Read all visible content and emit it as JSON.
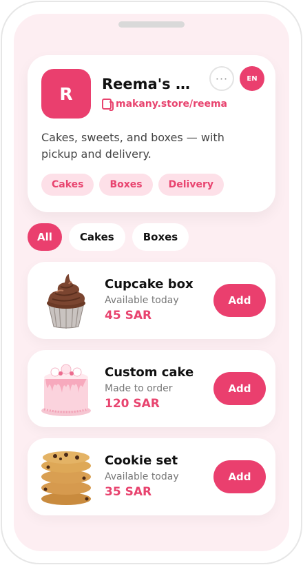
{
  "store": {
    "avatar_initial": "R",
    "name": "Reema's D…",
    "link": "makany.store/reema",
    "more_label": "···",
    "lang_label": "EN",
    "description": "Cakes, sweets, and boxes — with pickup and delivery.",
    "tags": [
      "Cakes",
      "Boxes",
      "Delivery"
    ]
  },
  "filters": {
    "items": [
      {
        "label": "All",
        "active": true
      },
      {
        "label": "Cakes",
        "active": false
      },
      {
        "label": "Boxes",
        "active": false
      }
    ]
  },
  "products": [
    {
      "name": "Cupcake box",
      "status": "Available today",
      "price": "45 SAR",
      "add_label": "Add",
      "image": "cupcake-image"
    },
    {
      "name": "Custom cake",
      "status": "Made to order",
      "price": "120 SAR",
      "add_label": "Add",
      "image": "cake-image"
    },
    {
      "name": "Cookie set",
      "status": "Available today",
      "price": "35 SAR",
      "add_label": "Add",
      "image": "cookies-image"
    }
  ],
  "colors": {
    "accent": "#ea3f6e",
    "background": "#fdeef2",
    "tag_background": "#fde0e8"
  }
}
